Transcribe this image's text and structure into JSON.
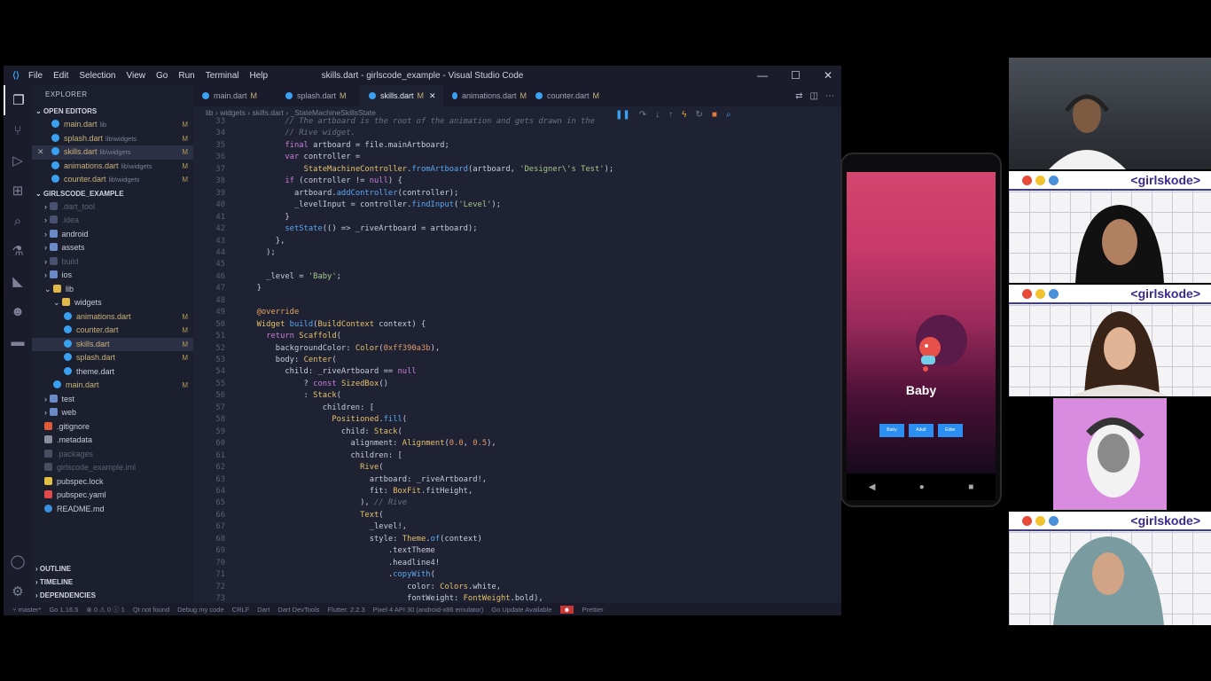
{
  "window": {
    "title": "skills.dart - girlscode_example - Visual Studio Code",
    "menu": [
      "File",
      "Edit",
      "Selection",
      "View",
      "Go",
      "Run",
      "Terminal",
      "Help"
    ]
  },
  "sidebar": {
    "header": "EXPLORER",
    "open_editors_label": "OPEN EDITORS",
    "open_editors": [
      {
        "name": "main.dart",
        "path": "lib",
        "status": "M"
      },
      {
        "name": "splash.dart",
        "path": "lib\\widgets",
        "status": "M"
      },
      {
        "name": "skills.dart",
        "path": "lib\\widgets",
        "status": "M"
      },
      {
        "name": "animations.dart",
        "path": "lib\\widgets",
        "status": "M"
      },
      {
        "name": "counter.dart",
        "path": "lib\\widgets",
        "status": "M"
      }
    ],
    "project_label": "GIRLSCODE_EXAMPLE",
    "tree": [
      {
        "name": ".dart_tool",
        "kind": "folder-dim"
      },
      {
        "name": ".idea",
        "kind": "folder-dim"
      },
      {
        "name": "android",
        "kind": "folder"
      },
      {
        "name": "assets",
        "kind": "folder"
      },
      {
        "name": "build",
        "kind": "folder-dim"
      },
      {
        "name": "ios",
        "kind": "folder"
      },
      {
        "name": "lib",
        "kind": "folder-open"
      },
      {
        "name": "widgets",
        "kind": "folder-open"
      },
      {
        "name": "animations.dart",
        "kind": "file",
        "status": "M"
      },
      {
        "name": "counter.dart",
        "kind": "file",
        "status": "M"
      },
      {
        "name": "skills.dart",
        "kind": "file",
        "status": "M"
      },
      {
        "name": "splash.dart",
        "kind": "file",
        "status": "M"
      },
      {
        "name": "theme.dart",
        "kind": "file"
      },
      {
        "name": "main.dart",
        "kind": "file",
        "status": "M"
      },
      {
        "name": "test",
        "kind": "folder"
      },
      {
        "name": "web",
        "kind": "folder"
      },
      {
        "name": ".gitignore",
        "kind": "git"
      },
      {
        "name": ".metadata",
        "kind": "meta"
      },
      {
        "name": ".packages",
        "kind": "dim"
      },
      {
        "name": "girlscode_example.iml",
        "kind": "dim"
      },
      {
        "name": "pubspec.lock",
        "kind": "lock"
      },
      {
        "name": "pubspec.yaml",
        "kind": "yaml"
      },
      {
        "name": "README.md",
        "kind": "info"
      }
    ],
    "outline_label": "OUTLINE",
    "timeline_label": "TIMELINE",
    "dependencies_label": "DEPENDENCIES"
  },
  "tabs": [
    {
      "label": "main.dart",
      "status": "M"
    },
    {
      "label": "splash.dart",
      "status": "M"
    },
    {
      "label": "skills.dart",
      "status": "M"
    },
    {
      "label": "animations.dart",
      "status": "M"
    },
    {
      "label": "counter.dart",
      "status": "M"
    }
  ],
  "breadcrumb": [
    "lib",
    "widgets",
    "skills.dart",
    "_StateMachineSkillsState"
  ],
  "statusbar": {
    "branch": "master*",
    "go_version": "Go 1.16.5",
    "problems": "⊗ 0 ⚠ 0 ⓘ 1",
    "qt": "Qt not found",
    "debug_mode": "Debug my code",
    "eol": "CRLF",
    "language": "Dart",
    "devtools": "Dart DevTools",
    "flutter": "Flutter: 2.2.3",
    "device": "Pixel 4 API 30 (android-x86 emulator)",
    "go_update": "Go Update Available",
    "prettier": "Prettier"
  },
  "code": {
    "lines": [
      {
        "n": "33",
        "html": "        <span class='c'>// The artboard is the root of the animation and gets drawn in the</span>"
      },
      {
        "n": "34",
        "html": "        <span class='c'>// Rive widget.</span>"
      },
      {
        "n": "35",
        "html": "        <span class='k'>final</span> artboard = file.mainArtboard;"
      },
      {
        "n": "36",
        "html": "        <span class='k'>var</span> controller ="
      },
      {
        "n": "37",
        "html": "            <span class='t'>StateMachineController</span>.<span class='f'>fromArtboard</span>(artboard, <span class='s'>'Designer\\'s Test'</span>);"
      },
      {
        "n": "38",
        "html": "        <span class='k'>if</span> (controller != <span class='k'>null</span>) {"
      },
      {
        "n": "39",
        "html": "          artboard.<span class='f'>addController</span>(controller);"
      },
      {
        "n": "40",
        "html": "          _levelInput = controller.<span class='f'>findInput</span>(<span class='s'>'Level'</span>);"
      },
      {
        "n": "41",
        "html": "        }"
      },
      {
        "n": "42",
        "html": "        <span class='f'>setState</span>(() => _riveArtboard = artboard);"
      },
      {
        "n": "43",
        "html": "      },"
      },
      {
        "n": "44",
        "html": "    );"
      },
      {
        "n": "45",
        "html": ""
      },
      {
        "n": "46",
        "html": "    _level = <span class='s'>'Baby'</span>;"
      },
      {
        "n": "47",
        "html": "  }"
      },
      {
        "n": "48",
        "html": ""
      },
      {
        "n": "49",
        "html": "  <span class='a'>@override</span>"
      },
      {
        "n": "50",
        "html": "  <span class='t'>Widget</span> <span class='f'>build</span>(<span class='t'>BuildContext</span> context) {"
      },
      {
        "n": "51",
        "html": "    <span class='k'>return</span> <span class='t'>Scaffold</span>("
      },
      {
        "n": "52",
        "html": "      backgroundColor: <span class='t'>Color</span>(<span class='n'>0xff390a3b</span>),"
      },
      {
        "n": "53",
        "html": "      body: <span class='t'>Center</span>("
      },
      {
        "n": "54",
        "html": "        child: _riveArtboard == <span class='k'>null</span>"
      },
      {
        "n": "55",
        "html": "            ? <span class='k'>const</span> <span class='t'>SizedBox</span>()"
      },
      {
        "n": "56",
        "html": "            : <span class='t'>Stack</span>("
      },
      {
        "n": "57",
        "html": "                children: ["
      },
      {
        "n": "58",
        "html": "                  <span class='t'>Positioned</span>.<span class='f'>fill</span>("
      },
      {
        "n": "59",
        "html": "                    child: <span class='t'>Stack</span>("
      },
      {
        "n": "60",
        "html": "                      alignment: <span class='t'>Alignment</span>(<span class='n'>0.0</span>, <span class='n'>0.5</span>),"
      },
      {
        "n": "61",
        "html": "                      children: ["
      },
      {
        "n": "62",
        "html": "                        <span class='t'>Rive</span>("
      },
      {
        "n": "63",
        "html": "                          artboard: _riveArtboard!,"
      },
      {
        "n": "64",
        "html": "                          fit: <span class='t'>BoxFit</span>.fitHeight,"
      },
      {
        "n": "65",
        "html": "                        ), <span class='c'>// Rive</span>"
      },
      {
        "n": "66",
        "html": "                        <span class='t'>Text</span>("
      },
      {
        "n": "67",
        "html": "                          _level!,"
      },
      {
        "n": "68",
        "html": "                          style: <span class='t'>Theme</span>.<span class='f'>of</span>(context)"
      },
      {
        "n": "69",
        "html": "                              .textTheme"
      },
      {
        "n": "70",
        "html": "                              .headline4!"
      },
      {
        "n": "71",
        "html": "                              .<span class='f'>copyWith</span>("
      },
      {
        "n": "72",
        "html": "                                  color: <span class='t'>Colors</span>.white,"
      },
      {
        "n": "73",
        "html": "                                  fontWeight: <span class='t'>FontWeight</span>.bold),"
      }
    ]
  },
  "phone": {
    "level_text": "Baby",
    "buttons": [
      "Baby",
      "Adult",
      "Elder"
    ]
  },
  "participants": {
    "brand": "<girlskode>",
    "dot_colors": [
      "#e84a3a",
      "#f2c230",
      "#4a8fd8"
    ]
  }
}
